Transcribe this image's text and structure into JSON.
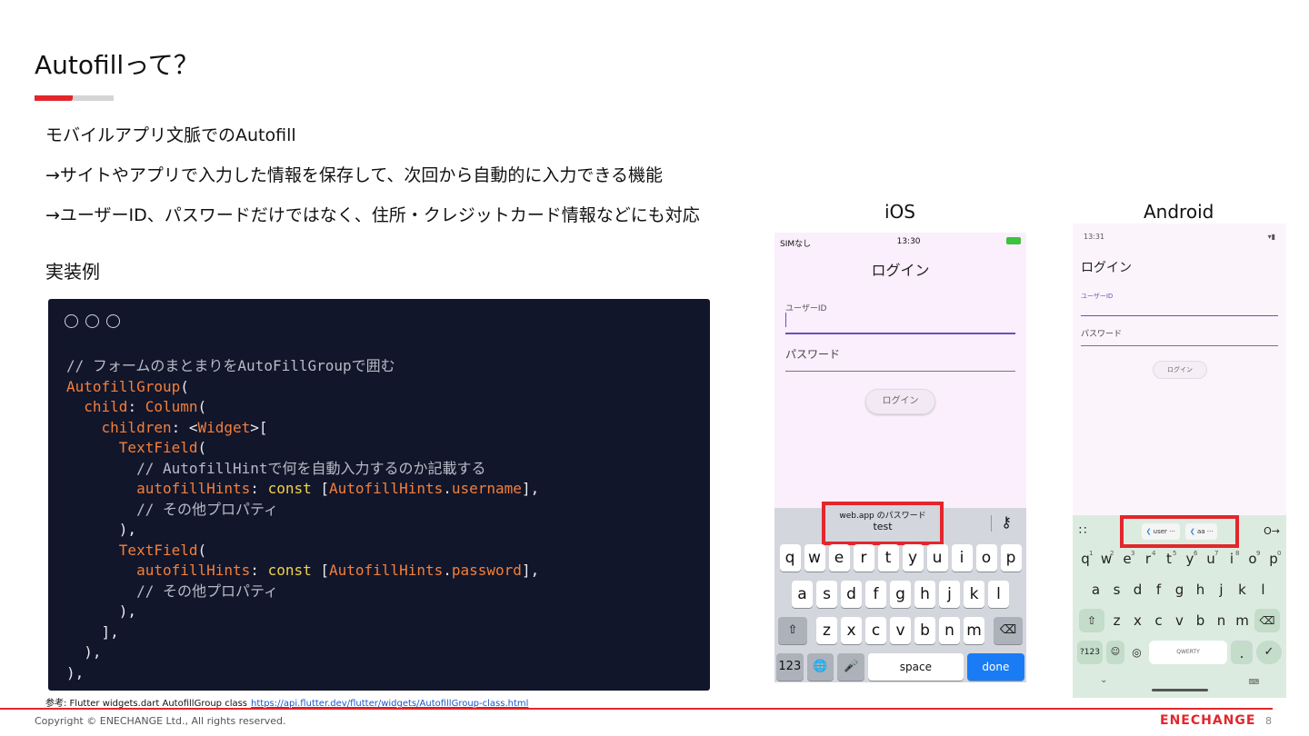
{
  "slide": {
    "title": "Autofillって？",
    "bullets": [
      "モバイルアプリ文脈でのAutofill",
      "→サイトやアプリで入力した情報を保存して、次回から自動的に入力できる機能",
      "→ユーザーID、パスワードだけではなく、住所・クレジットカード情報などにも対応"
    ],
    "subhead": "実装例",
    "reference_label": "参考: Flutter widgets.dart AutofillGroup class",
    "reference_link": "https://api.flutter.dev/flutter/widgets/AutofillGroup-class.html",
    "copyright": "Copyright © ENECHANGE Ltd., All rights reserved.",
    "brand": "ENECHANGE",
    "page_number": "8",
    "accent_color": "#e3262d"
  },
  "code": {
    "comment1": "// フォームのまとまりをAutoFillGroupで囲む",
    "autofill_group": "AutofillGroup",
    "child": "child",
    "column": "Column",
    "children": "children",
    "widget": "Widget",
    "textfield": "TextField",
    "comment2": "// AutofillHintで何を自動入力するのか記載する",
    "autofill_hints": "autofillHints",
    "const_kw": "const",
    "autofill_hints_class": "AutofillHints",
    "username": "username",
    "password": "password",
    "comment3": "// その他プロパティ"
  },
  "ios": {
    "label": "iOS",
    "carrier": "SIMなし",
    "time": "13:30",
    "app_title": "ログイン",
    "user_label": "ユーザーID",
    "password_label": "パスワード",
    "login_button": "ログイン",
    "suggestion_line1": "web.app のパスワード",
    "suggestion_line2": "test",
    "row1": [
      "q",
      "w",
      "e",
      "r",
      "t",
      "y",
      "u",
      "i",
      "o",
      "p"
    ],
    "row2": [
      "a",
      "s",
      "d",
      "f",
      "g",
      "h",
      "j",
      "k",
      "l"
    ],
    "row3": [
      "z",
      "x",
      "c",
      "v",
      "b",
      "n",
      "m"
    ],
    "key_123": "123",
    "key_space": "space",
    "key_done": "done"
  },
  "android": {
    "label": "Android",
    "time": "13:31",
    "app_title": "ログイン",
    "user_label": "ユーザーID",
    "password_label": "パスワード",
    "login_button": "ログイン",
    "chip1": "user ···",
    "chip2": "aa ···",
    "row1": [
      "q",
      "w",
      "e",
      "r",
      "t",
      "y",
      "u",
      "i",
      "o",
      "p"
    ],
    "row1_nums": [
      "1",
      "2",
      "3",
      "4",
      "5",
      "6",
      "7",
      "8",
      "9",
      "0"
    ],
    "row2": [
      "a",
      "s",
      "d",
      "f",
      "g",
      "h",
      "j",
      "k",
      "l"
    ],
    "row3": [
      "z",
      "x",
      "c",
      "v",
      "b",
      "n",
      "m"
    ],
    "key_num": "?123",
    "key_qwerty": "QWERTY",
    "key_period": "."
  }
}
